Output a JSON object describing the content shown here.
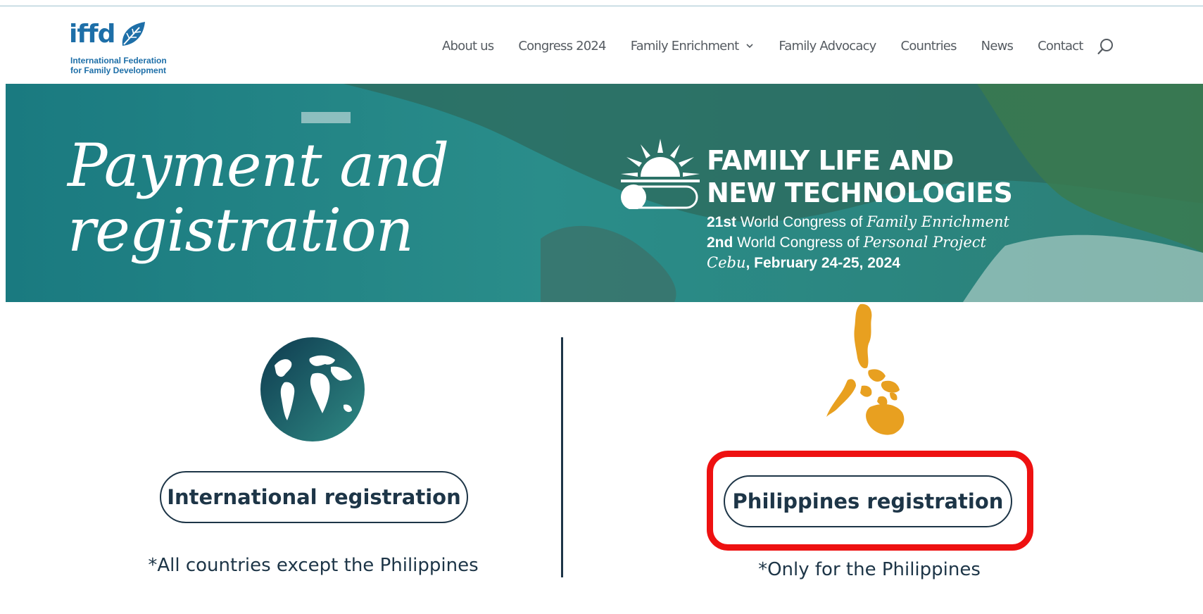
{
  "brand": {
    "logo_word": "iffd",
    "logo_line1": "International Federation",
    "logo_line2": "for Family Development",
    "primary_color": "#1e6fa8",
    "dark_color": "#1d3547",
    "accent_orange": "#e8a020"
  },
  "nav": {
    "items": [
      {
        "label": "About us"
      },
      {
        "label": "Congress 2024"
      },
      {
        "label": "Family Enrichment",
        "has_dropdown": true
      },
      {
        "label": "Family Advocacy"
      },
      {
        "label": "Countries"
      },
      {
        "label": "News"
      },
      {
        "label": "Contact"
      }
    ],
    "search_icon": "search-icon"
  },
  "hero": {
    "title_line1": "Payment and",
    "title_line2": "registration",
    "event_title_line1": "FAMILY LIFE AND",
    "event_title_line2": "NEW TECHNOLOGIES",
    "line1_bold": "21st",
    "line1_text": " World Congress of ",
    "line1_italic": "Family Enrichment",
    "line2_bold": "2nd",
    "line2_text": " World Congress of ",
    "line2_italic": "Personal Project",
    "line3_italic": "Cebu",
    "line3_text": ", February 24-25, 2024"
  },
  "options": {
    "international": {
      "button_label": "International registration",
      "note": "*All countries except the Philippines",
      "icon": "globe-icon"
    },
    "philippines": {
      "button_label": "Philippines registration",
      "note": "*Only for the Philippines",
      "icon": "philippines-map-icon",
      "highlight_color": "#ee1111"
    }
  }
}
